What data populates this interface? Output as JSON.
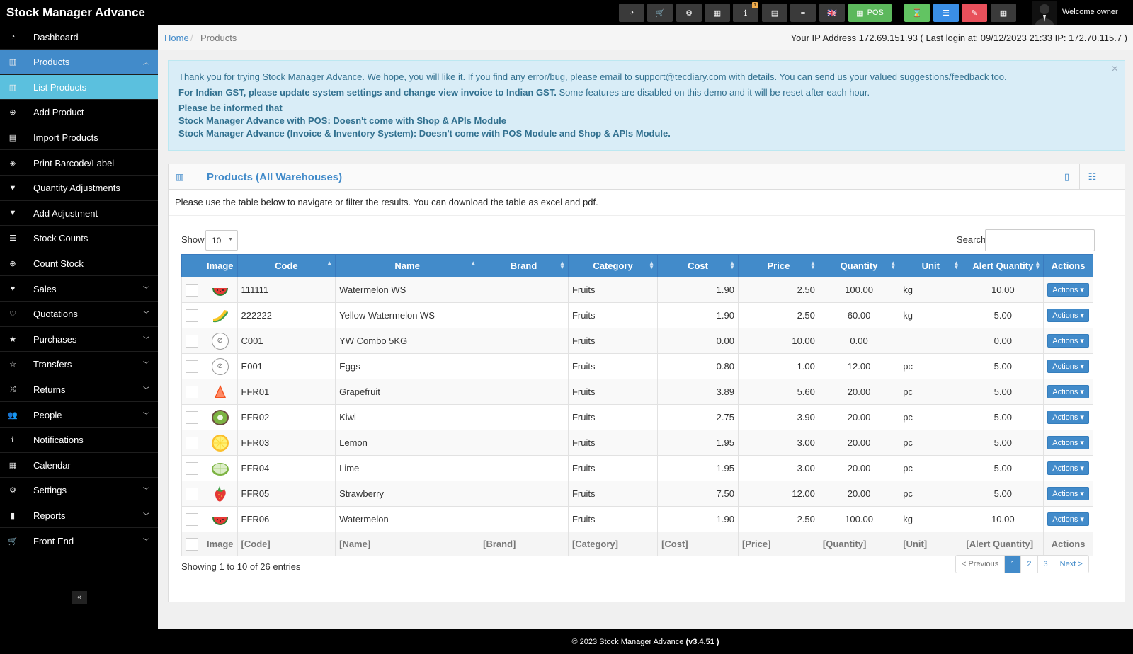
{
  "app": {
    "brand": "Stock Manager Advance"
  },
  "header": {
    "toolbar": [
      {
        "icon": "dashboard-icon",
        "glyph": "◔"
      },
      {
        "icon": "cart-icon",
        "glyph": "🛒"
      },
      {
        "icon": "cogs-icon",
        "glyph": "⚙"
      },
      {
        "icon": "calculator-icon",
        "glyph": "▦"
      },
      {
        "icon": "info-icon",
        "glyph": "ℹ",
        "badge": "1"
      },
      {
        "icon": "calendar-icon",
        "glyph": "▤"
      },
      {
        "icon": "receipt-icon",
        "glyph": "≡"
      },
      {
        "icon": "flag-uk-icon",
        "glyph": "🇬🇧"
      },
      {
        "icon": "pos-icon",
        "glyph": "▦",
        "label": "POS",
        "color": "#5cb85c"
      },
      {
        "icon": "hourglass-icon",
        "glyph": "⌛",
        "color": "#62c462"
      },
      {
        "icon": "list-icon",
        "glyph": "☰",
        "color": "#3a8ee6"
      },
      {
        "icon": "eraser-icon",
        "glyph": "✎",
        "color": "#e8505b"
      },
      {
        "icon": "apps-icon",
        "glyph": "▦"
      }
    ],
    "welcome": "Welcome owner"
  },
  "sidebar": {
    "items": [
      {
        "label": "Dashboard",
        "icon": "dashboard-icon",
        "glyph": "◔",
        "chevron": false,
        "state": ""
      },
      {
        "label": "Products",
        "icon": "barcode-icon",
        "glyph": "▥",
        "chevron": "up",
        "state": "active"
      },
      {
        "label": "List Products",
        "icon": "barcode-icon",
        "glyph": "▥",
        "chevron": false,
        "state": "sub-active"
      },
      {
        "label": "Add Product",
        "icon": "plus-circle-icon",
        "glyph": "⊕",
        "chevron": false,
        "state": ""
      },
      {
        "label": "Import Products",
        "icon": "file-icon",
        "glyph": "▤",
        "chevron": false,
        "state": ""
      },
      {
        "label": "Print Barcode/Label",
        "icon": "tags-icon",
        "glyph": "◈",
        "chevron": false,
        "state": ""
      },
      {
        "label": "Quantity Adjustments",
        "icon": "filter-icon",
        "glyph": "▼",
        "chevron": false,
        "state": ""
      },
      {
        "label": "Add Adjustment",
        "icon": "filter-icon",
        "glyph": "▼",
        "chevron": false,
        "state": ""
      },
      {
        "label": "Stock Counts",
        "icon": "list-ol-icon",
        "glyph": "☰",
        "chevron": false,
        "state": ""
      },
      {
        "label": "Count Stock",
        "icon": "plus-circle-icon",
        "glyph": "⊕",
        "chevron": false,
        "state": ""
      },
      {
        "label": "Sales",
        "icon": "heart-icon",
        "glyph": "♥",
        "chevron": "down",
        "state": ""
      },
      {
        "label": "Quotations",
        "icon": "heart-outline-icon",
        "glyph": "♡",
        "chevron": "down",
        "state": ""
      },
      {
        "label": "Purchases",
        "icon": "star-icon",
        "glyph": "★",
        "chevron": "down",
        "state": ""
      },
      {
        "label": "Transfers",
        "icon": "star-outline-icon",
        "glyph": "☆",
        "chevron": "down",
        "state": ""
      },
      {
        "label": "Returns",
        "icon": "random-icon",
        "glyph": "⤮",
        "chevron": "down",
        "state": ""
      },
      {
        "label": "People",
        "icon": "users-icon",
        "glyph": "👥",
        "chevron": "down",
        "state": ""
      },
      {
        "label": "Notifications",
        "icon": "info-circle-icon",
        "glyph": "ℹ",
        "chevron": false,
        "state": ""
      },
      {
        "label": "Calendar",
        "icon": "calendar-icon",
        "glyph": "▦",
        "chevron": false,
        "state": ""
      },
      {
        "label": "Settings",
        "icon": "cog-icon",
        "glyph": "⚙",
        "chevron": "down",
        "state": ""
      },
      {
        "label": "Reports",
        "icon": "bar-chart-icon",
        "glyph": "▮",
        "chevron": "down",
        "state": ""
      },
      {
        "label": "Front End",
        "icon": "cart-icon",
        "glyph": "🛒",
        "chevron": "down",
        "state": ""
      }
    ],
    "collapse_glyph": "«"
  },
  "breadcrumb": {
    "home": "Home",
    "separator": "/",
    "current": "Products"
  },
  "ip_info": "Your IP Address 172.69.151.93 ( Last login at: 09/12/2023 21:33 IP: 172.70.115.7 )",
  "alert": {
    "line1": "Thank you for trying Stock Manager Advance. We hope, you will like it. If you find any error/bug, please email to support@tecdiary.com with details. You can send us your valued suggestions/feedback too.",
    "line2_bold": "For Indian GST, please update system settings and change view invoice to Indian GST.",
    "line2_rest": " Some features are disabled on this demo and it will be reset after each hour.",
    "line3": "Please be informed that",
    "line4": "Stock Manager Advance with POS: Doesn't come with Shop & APIs Module",
    "line5": "Stock Manager Advance (Invoice & Inventory System): Doesn't come with POS Module and Shop & APIs Module.",
    "close": "×"
  },
  "box": {
    "title": "Products (All Warehouses)",
    "intro": "Please use the table below to navigate or filter the results. You can download the table as excel and pdf."
  },
  "table": {
    "show_label": "Show",
    "page_size": "10",
    "search_label": "Search",
    "search_value": "",
    "columns": [
      "Image",
      "Code",
      "Name",
      "Brand",
      "Category",
      "Cost",
      "Price",
      "Quantity",
      "Unit",
      "Alert Quantity",
      "Actions"
    ],
    "rows": [
      {
        "img": "watermelon",
        "code": "111111",
        "name": "Watermelon WS",
        "brand": "",
        "category": "Fruits",
        "cost": "1.90",
        "price": "2.50",
        "quantity": "100.00",
        "unit": "kg",
        "alert": "10.00"
      },
      {
        "img": "yellow-watermelon",
        "code": "222222",
        "name": "Yellow Watermelon WS",
        "brand": "",
        "category": "Fruits",
        "cost": "1.90",
        "price": "2.50",
        "quantity": "60.00",
        "unit": "kg",
        "alert": "5.00"
      },
      {
        "img": "none",
        "code": "C001",
        "name": "YW Combo 5KG",
        "brand": "",
        "category": "Fruits",
        "cost": "0.00",
        "price": "10.00",
        "quantity": "0.00",
        "unit": "",
        "alert": "0.00"
      },
      {
        "img": "none",
        "code": "E001",
        "name": "Eggs",
        "brand": "",
        "category": "Fruits",
        "cost": "0.80",
        "price": "1.00",
        "quantity": "12.00",
        "unit": "pc",
        "alert": "5.00"
      },
      {
        "img": "grapefruit",
        "code": "FFR01",
        "name": "Grapefruit",
        "brand": "",
        "category": "Fruits",
        "cost": "3.89",
        "price": "5.60",
        "quantity": "20.00",
        "unit": "pc",
        "alert": "5.00"
      },
      {
        "img": "kiwi",
        "code": "FFR02",
        "name": "Kiwi",
        "brand": "",
        "category": "Fruits",
        "cost": "2.75",
        "price": "3.90",
        "quantity": "20.00",
        "unit": "pc",
        "alert": "5.00"
      },
      {
        "img": "lemon",
        "code": "FFR03",
        "name": "Lemon",
        "brand": "",
        "category": "Fruits",
        "cost": "1.95",
        "price": "3.00",
        "quantity": "20.00",
        "unit": "pc",
        "alert": "5.00"
      },
      {
        "img": "lime",
        "code": "FFR04",
        "name": "Lime",
        "brand": "",
        "category": "Fruits",
        "cost": "1.95",
        "price": "3.00",
        "quantity": "20.00",
        "unit": "pc",
        "alert": "5.00"
      },
      {
        "img": "strawberry",
        "code": "FFR05",
        "name": "Strawberry",
        "brand": "",
        "category": "Fruits",
        "cost": "7.50",
        "price": "12.00",
        "quantity": "20.00",
        "unit": "pc",
        "alert": "5.00"
      },
      {
        "img": "watermelon",
        "code": "FFR06",
        "name": "Watermelon",
        "brand": "",
        "category": "Fruits",
        "cost": "1.90",
        "price": "2.50",
        "quantity": "100.00",
        "unit": "kg",
        "alert": "10.00"
      }
    ],
    "action_label": "Actions ▾",
    "footer": [
      "Image",
      "[Code]",
      "[Name]",
      "[Brand]",
      "[Category]",
      "[Cost]",
      "[Price]",
      "[Quantity]",
      "[Unit]",
      "[Alert Quantity]",
      "Actions"
    ],
    "showing": "Showing 1 to 10 of 26 entries",
    "pagination": [
      "< Previous",
      "1",
      "2",
      "3",
      "Next >"
    ],
    "current_page": "1"
  },
  "footer": {
    "text": "© 2023 Stock Manager Advance ",
    "version": "(v3.4.51 )"
  }
}
